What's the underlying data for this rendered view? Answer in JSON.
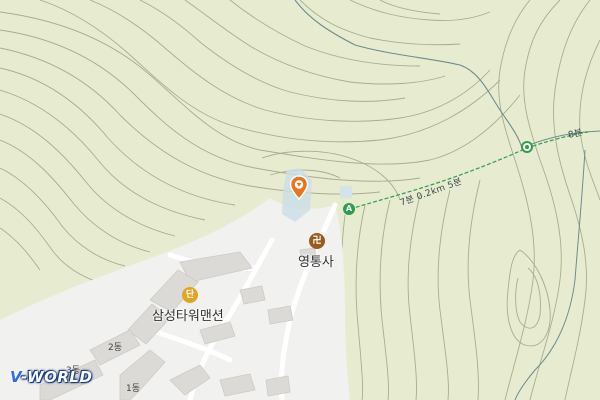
{
  "map": {
    "temple": {
      "name": "영통사",
      "icon": "temple-icon",
      "glyph": "卍"
    },
    "apartment": {
      "name": "삼성타워맨션",
      "icon": "apartment-icon",
      "glyph": "단"
    },
    "buildings": [
      {
        "id": "bldg-2",
        "label": "2동"
      },
      {
        "id": "bldg-3",
        "label": "3동"
      },
      {
        "id": "bldg-1",
        "label": "1동"
      }
    ],
    "trail": {
      "segment_label": "7분 0.2km 5분",
      "segment_label_2": "8분",
      "start_icon": "trail-start-icon",
      "node_icon": "trail-node-icon",
      "color": "#2e9e4e"
    },
    "marker": {
      "icon": "location-pin-icon",
      "color": "#e8761e"
    },
    "colors": {
      "terrain": "#e7ecd1",
      "urban": "#f1f1ef",
      "contour": "#a9ad8e",
      "water": "#c9dfe6"
    }
  },
  "logo": {
    "prefix": "V",
    "text": "-WORLD"
  }
}
